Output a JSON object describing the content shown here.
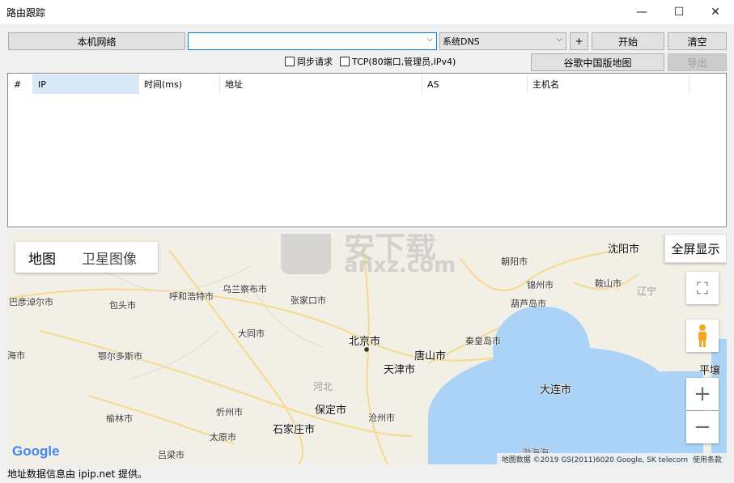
{
  "window": {
    "title": "路由跟踪",
    "minimize": "—",
    "maximize": "☐",
    "close": "✕"
  },
  "toolbar": {
    "local_network": "本机网络",
    "target_value": "",
    "target_arrow": "⌵",
    "dns_value": "系统DNS",
    "dns_arrow": "⌵",
    "plus": "+",
    "start": "开始",
    "clear": "清空",
    "google_china_map": "谷歌中国版地图",
    "export": "导出",
    "sync_request": "同步请求",
    "tcp": "TCP(80端口,管理员,IPv4)"
  },
  "table": {
    "columns": [
      "#",
      "IP",
      "时间(ms)",
      "地址",
      "AS",
      "主机名"
    ]
  },
  "map": {
    "tab_map": "地图",
    "tab_satellite": "卫星图像",
    "fullscreen": "全屏显示",
    "expand_icon": "⛶",
    "zoom_in": "+",
    "zoom_out": "−",
    "provinces": [
      "河北",
      "辽宁"
    ],
    "cities": [
      "巴彦淖尔市",
      "包头市",
      "呼和浩特市",
      "乌兰察布市",
      "张家口市",
      "朝阳市",
      "沈阳市",
      "锦州市",
      "鞍山市",
      "葫芦岛市",
      "大同市",
      "北京市",
      "唐山市",
      "秦皇岛市",
      "鄂尔多斯市",
      "天津市",
      "大连市",
      "平壤",
      "保定市",
      "忻州市",
      "榆林市",
      "石家庄市",
      "太原市",
      "沧州市",
      "吕梁市",
      "海市"
    ],
    "watermark": "安下载",
    "watermark_url": "anxz.com",
    "google_logo": "Google",
    "attribution": "地图数据 ©2019 GS(2011)6020 Google, SK telecom",
    "terms": "使用条款",
    "sea_label": "渤海海"
  },
  "status": "地址数据信息由 ipip.net 提供。"
}
